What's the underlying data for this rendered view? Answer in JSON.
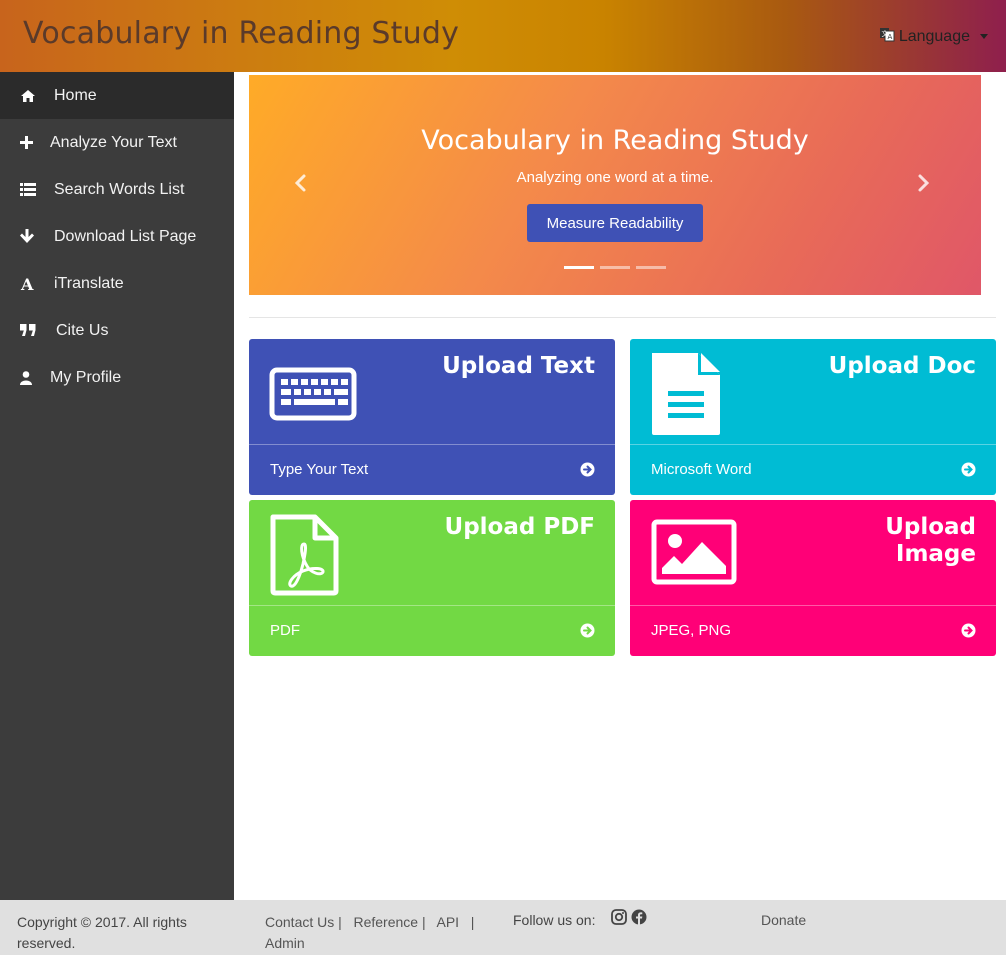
{
  "header": {
    "title": "Vocabulary in Reading Study",
    "language_label": "Language"
  },
  "sidebar": {
    "items": [
      {
        "label": "Home",
        "icon": "home-icon"
      },
      {
        "label": "Analyze Your Text",
        "icon": "plus-icon"
      },
      {
        "label": "Search Words List",
        "icon": "list-icon"
      },
      {
        "label": "Download List Page",
        "icon": "arrow-down-icon"
      },
      {
        "label": "iTranslate",
        "icon": "font-icon"
      },
      {
        "label": "Cite Us",
        "icon": "quote-icon"
      },
      {
        "label": "My Profile",
        "icon": "user-icon"
      }
    ]
  },
  "carousel": {
    "title": "Vocabulary in Reading Study",
    "subtitle": "Analyzing one word at a time.",
    "button_label": "Measure Readability",
    "active_slide": 1,
    "slide_count": 3
  },
  "cards": [
    {
      "title": "Upload Text",
      "footer": "Type Your Text",
      "color": "#3f51b5",
      "icon": "keyboard-icon"
    },
    {
      "title": "Upload Doc",
      "footer": "Microsoft Word",
      "color": "#00bcd4",
      "icon": "document-icon"
    },
    {
      "title": "Upload PDF",
      "footer": "PDF",
      "color": "#72d944",
      "icon": "pdf-icon"
    },
    {
      "title": "Upload Image",
      "footer": "JPEG, PNG",
      "color": "#ff0077",
      "icon": "image-icon"
    }
  ],
  "footer": {
    "copyright": "Copyright © 2017. All rights reserved.",
    "links": {
      "contact": "Contact Us",
      "reference": "Reference",
      "api": "API",
      "admin": "Admin"
    },
    "separator": "|",
    "follow_label": "Follow us on:",
    "donate": "Donate"
  }
}
